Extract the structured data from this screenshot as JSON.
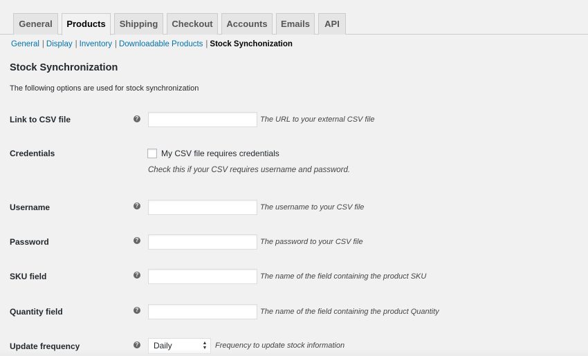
{
  "tabs": [
    {
      "label": "General",
      "active": false
    },
    {
      "label": "Products",
      "active": true
    },
    {
      "label": "Shipping",
      "active": false
    },
    {
      "label": "Checkout",
      "active": false
    },
    {
      "label": "Accounts",
      "active": false
    },
    {
      "label": "Emails",
      "active": false
    },
    {
      "label": "API",
      "active": false
    }
  ],
  "subnav": {
    "separator": "|",
    "items": [
      "General",
      "Display",
      "Inventory",
      "Downloadable Products"
    ],
    "current": "Stock Synchonization"
  },
  "section": {
    "title": "Stock Synchronization",
    "intro": "The following options are used for stock synchronization"
  },
  "fields": {
    "help_glyph": "?",
    "csv_link": {
      "label": "Link to CSV file",
      "value": "",
      "description": "The URL to your external CSV file"
    },
    "credentials": {
      "label": "Credentials",
      "checkbox_label": "My CSV file requires credentials",
      "checked": false,
      "description": "Check this if your CSV requires username and password."
    },
    "username": {
      "label": "Username",
      "value": "",
      "description": "The username to your CSV file"
    },
    "password": {
      "label": "Password",
      "value": "",
      "description": "The password to your CSV file"
    },
    "sku_field": {
      "label": "SKU field",
      "value": "",
      "description": "The name of the field containing the product SKU"
    },
    "quantity_field": {
      "label": "Quantity field",
      "value": "",
      "description": "The name of the field containing the product Quantity"
    },
    "update_frequency": {
      "label": "Update frequency",
      "selected": "Daily",
      "description": "Frequency to update stock information"
    }
  },
  "colors": {
    "background": "#f1f1f1",
    "link": "#0073aa",
    "text": "#23282d",
    "tab_inactive": "#e5e5e5"
  }
}
